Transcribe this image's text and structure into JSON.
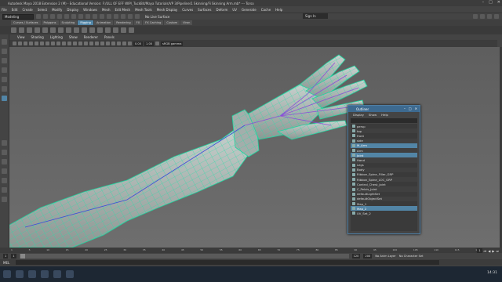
{
  "window": {
    "title": "Autodesk Maya 2018 Extension 2 (M) - Educational Version: F:/ULL OF EFF WIP/_TuckBit/Maya Tutorials/VP 3/Pipeline/1 Skinning/Fi Skinning Arm.mb* --- Torso",
    "controls": [
      "–",
      "□",
      "✕"
    ]
  },
  "menubar": [
    "File",
    "Edit",
    "Create",
    "Select",
    "Modify",
    "Display",
    "Windows",
    "Mesh",
    "Edit Mesh",
    "Mesh Tools",
    "Mesh Display",
    "Curves",
    "Surfaces",
    "Deform",
    "UV",
    "Generate",
    "Cache",
    "Help"
  ],
  "status": {
    "mode": "Modeling",
    "no_live_surface": "No Live Surface",
    "sign_in": "Sign In"
  },
  "shelf_tabs": [
    "Curves / Surfaces",
    "Polygons",
    "Sculpting",
    "Rigging",
    "Animation",
    "Rendering",
    "FX",
    "FX Caching",
    "Custom",
    "Viron"
  ],
  "active_shelf_tab": "Rigging",
  "panel_menu": [
    "View",
    "Shading",
    "Lighting",
    "Show",
    "Renderer",
    "Panels"
  ],
  "panel_fields": {
    "near": "0.00",
    "far": "1.00",
    "color_space": "sRGB gamma"
  },
  "outliner": {
    "title": "Outliner",
    "menu": [
      "Display",
      "Show",
      "Help"
    ],
    "items": [
      {
        "label": "persp",
        "selected": false
      },
      {
        "label": "top",
        "selected": false
      },
      {
        "label": "front",
        "selected": false
      },
      {
        "label": "side",
        "selected": false
      },
      {
        "label": "M_Arm",
        "selected": true
      },
      {
        "label": "Arm",
        "selected": false
      },
      {
        "label": "Joint",
        "selected": true
      },
      {
        "label": "Hand",
        "selected": false
      },
      {
        "label": "Legs",
        "selected": false
      },
      {
        "label": "Body",
        "selected": false
      },
      {
        "label": "Ribbon_Spine_Filler_GRP",
        "selected": false
      },
      {
        "label": "Ribbon_Spine_LOC_GRP",
        "selected": false
      },
      {
        "label": "Control_Chest_Joint",
        "selected": false
      },
      {
        "label": "C_Pelvis_Joint",
        "selected": false
      },
      {
        "label": "defaultLightSet",
        "selected": false
      },
      {
        "label": "defaultObjectSet",
        "selected": false
      },
      {
        "label": "Map_1",
        "selected": false
      },
      {
        "label": "Map_2",
        "selected": true
      },
      {
        "label": "UV_Set_2",
        "selected": false
      }
    ]
  },
  "timeline": {
    "ticks": [
      "1",
      "5",
      "10",
      "15",
      "20",
      "25",
      "30",
      "35",
      "40",
      "45",
      "50",
      "55",
      "60",
      "65",
      "70",
      "75",
      "80",
      "85",
      "90",
      "95",
      "100",
      "105",
      "110",
      "115",
      "120"
    ],
    "current_frame": "1"
  },
  "range": {
    "start": "1",
    "inner_start": "1",
    "inner_end": "120",
    "end": "200",
    "anim_layer": "No Anim Layer",
    "char_set": "No Character Set"
  },
  "cmdline": {
    "lang": "MEL"
  },
  "taskbar": {
    "time": "14:31"
  }
}
